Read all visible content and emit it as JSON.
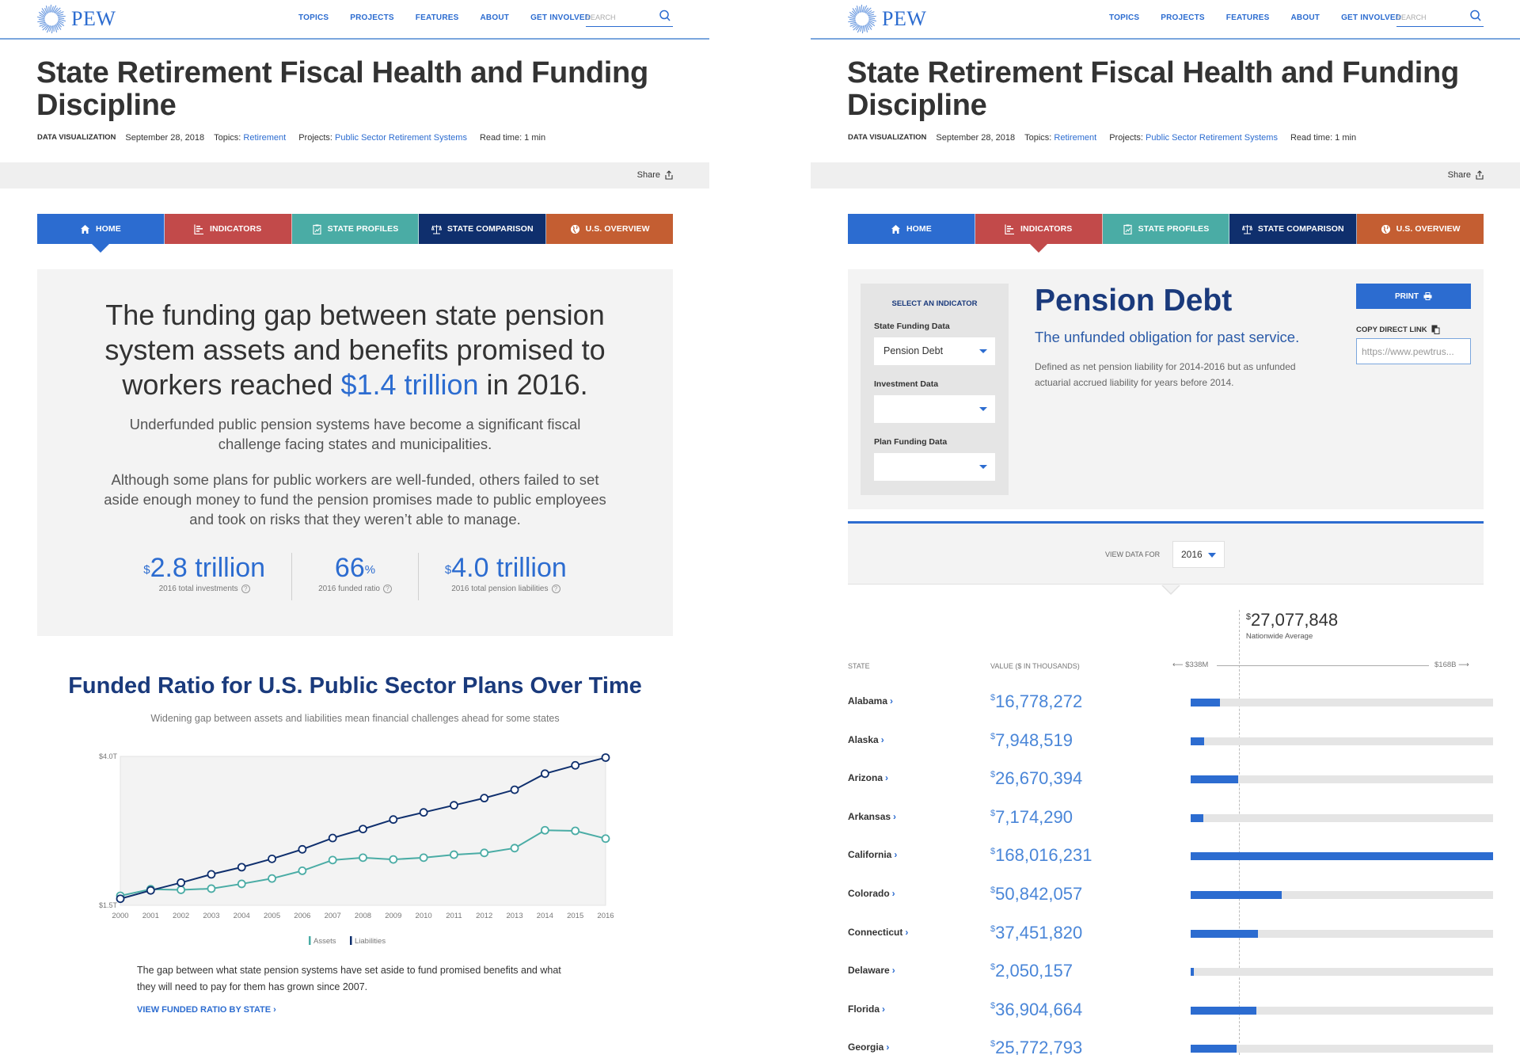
{
  "colors": {
    "brand_blue": "#2c6cd0",
    "navy": "#1a3a7c",
    "tab_home": "#2c6cd0",
    "tab_indicators": "#c24a4a",
    "tab_state_profiles": "#4aaca5",
    "tab_state_comparison": "#0f2f6d",
    "tab_us_overview": "#c45e32",
    "assets_series": "#4aaca5",
    "liabilities_series": "#0f2f6d"
  },
  "header": {
    "logo_text": "PEW",
    "nav": [
      "TOPICS",
      "PROJECTS",
      "FEATURES",
      "ABOUT",
      "GET INVOLVED"
    ],
    "search_placeholder": "SEARCH"
  },
  "article": {
    "title": "State Retirement Fiscal Health and Funding Discipline",
    "type": "DATA VISUALIZATION",
    "date": "September 28, 2018",
    "topics_label": "Topics:",
    "topics_value": "Retirement",
    "projects_label": "Projects:",
    "projects_value": "Public Sector Retirement Systems",
    "read_time": "Read time: 1 min",
    "share_label": "Share"
  },
  "tabs": [
    {
      "label": "HOME",
      "icon": "home-icon"
    },
    {
      "label": "INDICATORS",
      "icon": "bar-list-icon"
    },
    {
      "label": "STATE PROFILES",
      "icon": "clipboard-chart-icon"
    },
    {
      "label": "STATE COMPARISON",
      "icon": "scale-icon"
    },
    {
      "label": "U.S. OVERVIEW",
      "icon": "globe-icon"
    }
  ],
  "left": {
    "active_tab": "HOME",
    "hero": {
      "lead_pre": "The funding gap between state pension system assets and benefits promised to workers reached ",
      "lead_highlight": "$1.4 trillion",
      "lead_post": " in 2016.",
      "p1": "Underfunded public pension systems have become a significant fiscal challenge facing states and municipalities.",
      "p2": "Although some plans for public workers are well-funded, others failed to set aside enough money to fund the pension promises made to public employees and took on risks that they weren’t able to manage.",
      "stats": [
        {
          "prefix": "$",
          "value": "2.8 trillion",
          "suffix": "",
          "label": "2016 total investments"
        },
        {
          "prefix": "",
          "value": "66",
          "suffix": "%",
          "label": "2016 funded ratio"
        },
        {
          "prefix": "$",
          "value": "4.0 trillion",
          "suffix": "",
          "label": "2016 total pension liabilities"
        }
      ]
    },
    "chart_title": "Funded Ratio for U.S. Public Sector Plans Over Time",
    "chart_subtitle": "Widening gap between assets and liabilities mean financial challenges ahead for some states",
    "note": "The gap between what state pension systems have set aside to fund promised benefits and what they will need to pay for them has grown since 2007.",
    "link": "VIEW FUNDED RATIO BY STATE ›"
  },
  "chart_data": [
    {
      "type": "line",
      "title": "Funded Ratio for U.S. Public Sector Plans Over Time",
      "subtitle": "Widening gap between assets and liabilities mean financial challenges ahead for some states",
      "xlabel": "",
      "ylabel": "",
      "x": [
        2000,
        2001,
        2002,
        2003,
        2004,
        2005,
        2006,
        2007,
        2008,
        2009,
        2010,
        2011,
        2012,
        2013,
        2014,
        2015,
        2016
      ],
      "ylim": [
        1.5,
        4.0
      ],
      "ytick_labels": [
        "$1.5T",
        "$4.0T"
      ],
      "yticks": [
        1.5,
        4.0
      ],
      "units": "trillions of dollars",
      "grid": false,
      "legend": "bottom-center",
      "series": [
        {
          "name": "Assets",
          "values": [
            1.66,
            1.77,
            1.76,
            1.78,
            1.86,
            1.95,
            2.08,
            2.26,
            2.3,
            2.27,
            2.3,
            2.35,
            2.38,
            2.46,
            2.76,
            2.75,
            2.62
          ]
        },
        {
          "name": "Liabilities",
          "values": [
            1.61,
            1.75,
            1.88,
            2.02,
            2.14,
            2.28,
            2.44,
            2.63,
            2.78,
            2.94,
            3.06,
            3.18,
            3.3,
            3.44,
            3.71,
            3.85,
            3.98
          ]
        }
      ]
    },
    {
      "type": "bar",
      "title": "Pension Debt",
      "xlabel": "VALUE ($ IN THOUSANDS)",
      "range_labels": [
        "$338M",
        "$168B"
      ],
      "xlim": [
        338000,
        168016231
      ],
      "reference_line": {
        "label": "Nationwide Average",
        "value": 27077848
      },
      "categories": [
        "Alabama",
        "Alaska",
        "Arizona",
        "Arkansas",
        "California",
        "Colorado",
        "Connecticut",
        "Delaware",
        "Florida",
        "Georgia"
      ],
      "values": [
        16778272,
        7948519,
        26670394,
        7174290,
        168016231,
        50842057,
        37451820,
        2050157,
        36904664,
        25772793
      ]
    }
  ],
  "right": {
    "active_tab": "INDICATORS",
    "selector": {
      "heading": "SELECT AN INDICATOR",
      "groups": [
        {
          "label": "State Funding Data",
          "value": "Pension Debt"
        },
        {
          "label": "Investment Data",
          "value": ""
        },
        {
          "label": "Plan Funding Data",
          "value": ""
        }
      ]
    },
    "indicator": {
      "title": "Pension Debt",
      "subtitle": "The unfunded obligation for past service.",
      "description": "Defined as net pension liability for 2014-2016 but as unfunded actuarial accrued liability for years before 2014."
    },
    "print_label": "PRINT",
    "copy_label": "COPY DIRECT LINK",
    "copy_value": "https://www.pewtrus...",
    "view_data_label": "VIEW DATA FOR",
    "year": "2016",
    "average_prefix": "$",
    "average_value": "27,077,848",
    "average_label": "Nationwide Average",
    "col_state": "STATE",
    "col_value": "VALUE ($ IN THOUSANDS)",
    "scale_min": "$338M",
    "scale_max": "$168B",
    "rows": [
      {
        "state": "Alabama",
        "value": "16,778,272"
      },
      {
        "state": "Alaska",
        "value": "7,948,519"
      },
      {
        "state": "Arizona",
        "value": "26,670,394"
      },
      {
        "state": "Arkansas",
        "value": "7,174,290"
      },
      {
        "state": "California",
        "value": "168,016,231"
      },
      {
        "state": "Colorado",
        "value": "50,842,057"
      },
      {
        "state": "Connecticut",
        "value": "37,451,820"
      },
      {
        "state": "Delaware",
        "value": "2,050,157"
      },
      {
        "state": "Florida",
        "value": "36,904,664"
      },
      {
        "state": "Georgia",
        "value": "25,772,793"
      }
    ]
  }
}
